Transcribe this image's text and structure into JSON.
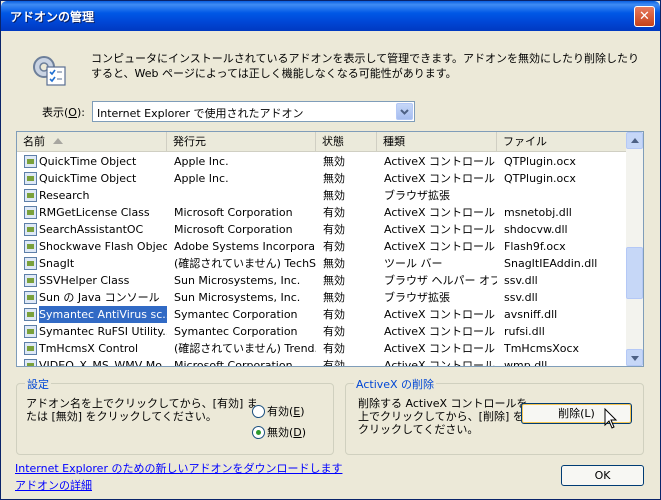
{
  "window": {
    "title": "アドオンの管理"
  },
  "intro": {
    "text": "コンピュータにインストールされているアドオンを表示して管理できます。アドオンを無効にしたり削除したりすると、Web ページによっては正しく機能しなくなる可能性があります。"
  },
  "show": {
    "label_prefix": "表示(",
    "label_key": "O",
    "label_suffix": "):",
    "selected": "Internet Explorer で使用されたアドオン"
  },
  "list": {
    "columns": [
      "名前",
      "発行元",
      "状態",
      "種類",
      "ファイル"
    ],
    "rows": [
      [
        "QuickTime Object",
        "Apple Inc.",
        "無効",
        "ActiveX コントロール",
        "QTPlugin.ocx"
      ],
      [
        "QuickTime Object",
        "Apple Inc.",
        "無効",
        "ActiveX コントロール",
        "QTPlugin.ocx"
      ],
      [
        "Research",
        "",
        "無効",
        "ブラウザ拡張",
        ""
      ],
      [
        "RMGetLicense Class",
        "Microsoft Corporation",
        "有効",
        "ActiveX コントロール",
        "msnetobj.dll"
      ],
      [
        "SearchAssistantOC",
        "Microsoft Corporation",
        "有効",
        "ActiveX コントロール",
        "shdocvw.dll"
      ],
      [
        "Shockwave Flash Object",
        "Adobe Systems Incorpora...",
        "有効",
        "ActiveX コントロール",
        "Flash9f.ocx"
      ],
      [
        "SnagIt",
        "(確認されていません) TechSm...",
        "無効",
        "ツール バー",
        "SnagItIEAddin.dll"
      ],
      [
        "SSVHelper Class",
        "Sun Microsystems, Inc.",
        "無効",
        "ブラウザ ヘルパー オブ...",
        "ssv.dll"
      ],
      [
        "Sun の Java コンソール",
        "Sun Microsystems, Inc.",
        "無効",
        "ブラウザ拡張",
        "ssv.dll"
      ],
      [
        "Symantec AntiVirus sc...",
        "Symantec Corporation",
        "有効",
        "ActiveX コントロール",
        "avsniff.dll"
      ],
      [
        "Symantec RuFSI Utility...",
        "Symantec Corporation",
        "有効",
        "ActiveX コントロール",
        "rufsi.dll"
      ],
      [
        "TmHcmsX Control",
        "(確認されていません) Trend...",
        "有効",
        "ActiveX コントロール",
        "TmHcmsXocx"
      ],
      [
        "VIDEO_X_MS_WMV Mo...",
        "Microsoft Corporation",
        "有効",
        "ActiveX コントロール",
        "wmp.dll"
      ]
    ],
    "selected_index": 9
  },
  "settings": {
    "title": "設定",
    "text": "アドオン名を上でクリックしてから、[有効] または [無効] をクリックしてください。",
    "enable_label": "有効(",
    "enable_key": "E",
    "disable_label": "無効(",
    "disable_key": "D",
    "close_paren": ")"
  },
  "activex_delete": {
    "title": "ActiveX の削除",
    "text": "削除する ActiveX コントロールを上でクリックしてから、[削除] をクリックしてください。",
    "button_label": "削除(L)"
  },
  "links": {
    "download": "Internet Explorer のための新しいアドオンをダウンロードします",
    "details": "アドオンの詳細"
  },
  "ok_label": "OK",
  "close_glyph": "✕"
}
